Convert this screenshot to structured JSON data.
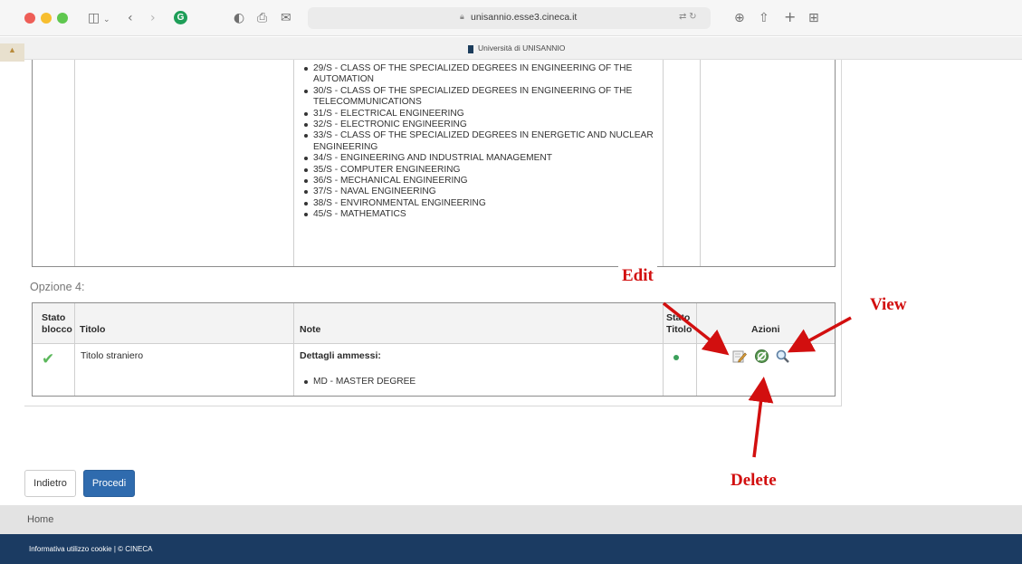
{
  "browser": {
    "url": "unisannio.esse3.cineca.it",
    "tab_title": "Università di UNISANNIO",
    "icons": [
      "sidebar-icon",
      "back-icon",
      "forward-icon",
      "grammarly-icon",
      "shield-icon",
      "print-icon",
      "mail-icon",
      "translate-icon",
      "reload-icon",
      "download-icon",
      "share-icon",
      "new-tab-icon",
      "tab-overview-icon"
    ]
  },
  "degrees": [
    "29/S - CLASS OF THE SPECIALIZED DEGREES IN ENGINEERING OF THE AUTOMATION",
    "30/S - CLASS OF THE SPECIALIZED DEGREES IN ENGINEERING OF THE TELECOMMUNICATIONS",
    "31/S - ELECTRICAL ENGINEERING",
    "32/S - ELECTRONIC ENGINEERING",
    "33/S - CLASS OF THE SPECIALIZED DEGREES IN ENERGETIC AND NUCLEAR ENGINEERING",
    "34/S - ENGINEERING AND INDUSTRIAL MANAGEMENT",
    "35/S - COMPUTER ENGINEERING",
    "36/S - MECHANICAL ENGINEERING",
    "37/S - NAVAL ENGINEERING",
    "38/S - ENVIRONMENTAL ENGINEERING",
    "45/S - MATHEMATICS"
  ],
  "option": {
    "label": "Opzione 4:",
    "headers": {
      "stato_blocco_1": "Stato",
      "stato_blocco_2": "blocco",
      "titolo": "Titolo",
      "note": "Note",
      "stato_titolo_1": "Stato",
      "stato_titolo_2": "Titolo",
      "azioni": "Azioni"
    },
    "row": {
      "titolo": "Titolo straniero",
      "note_heading": "Dettagli ammessi:",
      "note_item": "MD - MASTER DEGREE",
      "status_color": "#3ba05a"
    }
  },
  "buttons": {
    "back": "Indietro",
    "proceed": "Procedi"
  },
  "home_link": "Home",
  "footer_text": "Informativa utilizzo cookie | © CINECA",
  "annotations": {
    "edit": "Edit",
    "view": "View",
    "delete": "Delete",
    "color": "#d20f0f"
  },
  "colors": {
    "primary_button": "#2f6bae",
    "footer": "#1b3b62",
    "check": "#5cb85c"
  }
}
